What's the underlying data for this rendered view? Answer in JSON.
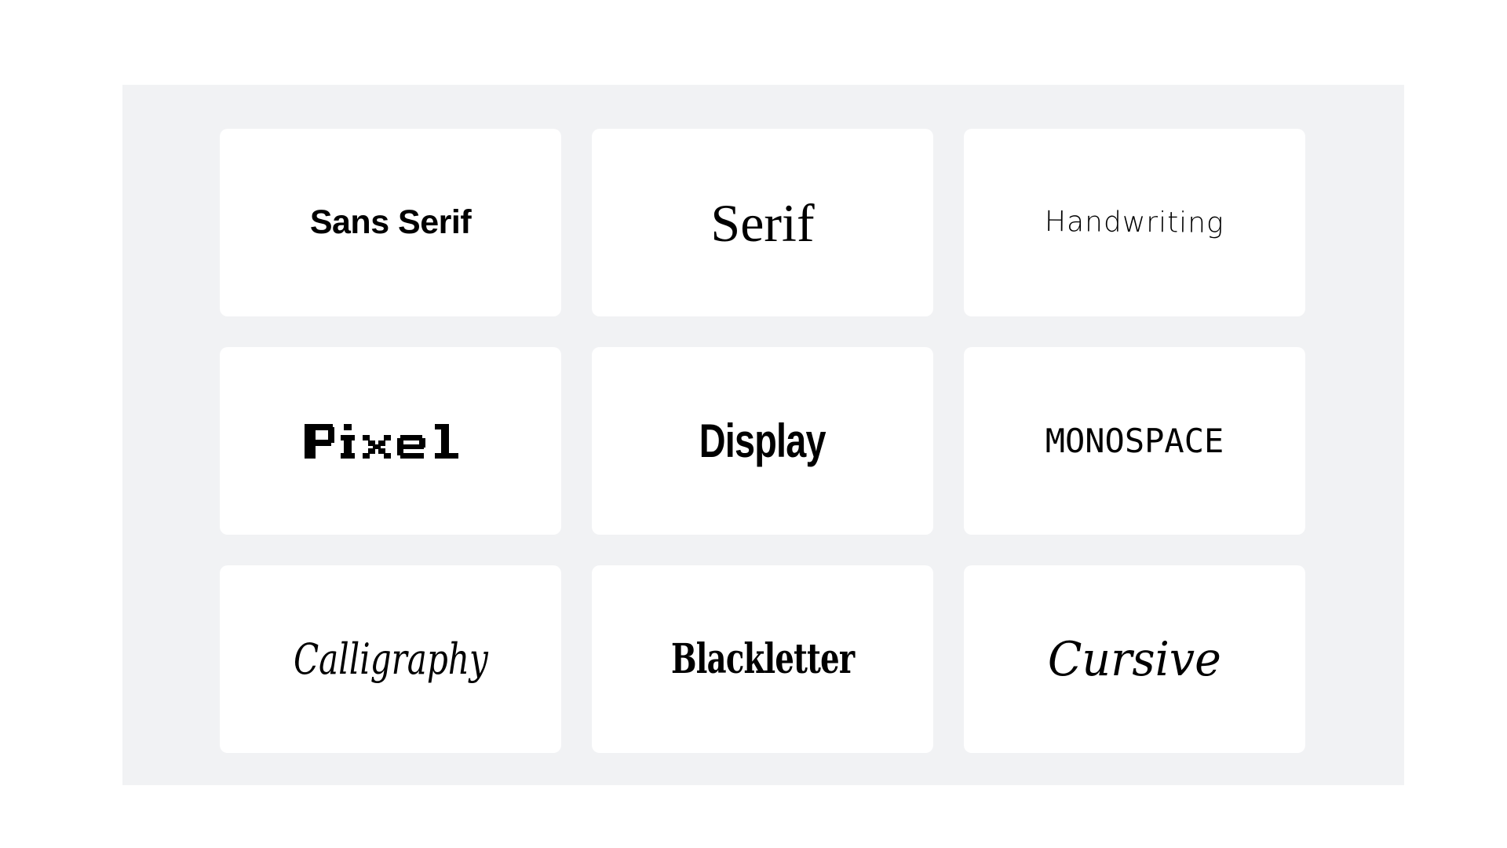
{
  "fonts": [
    {
      "label": "Sans Serif"
    },
    {
      "label": "Serif"
    },
    {
      "label": "Handwriting"
    },
    {
      "label": "Pixel"
    },
    {
      "label": "Display"
    },
    {
      "label": "MONOSPACE"
    },
    {
      "label": "Calligraphy"
    },
    {
      "label": "Blackletter"
    },
    {
      "label": "Cursive"
    }
  ]
}
